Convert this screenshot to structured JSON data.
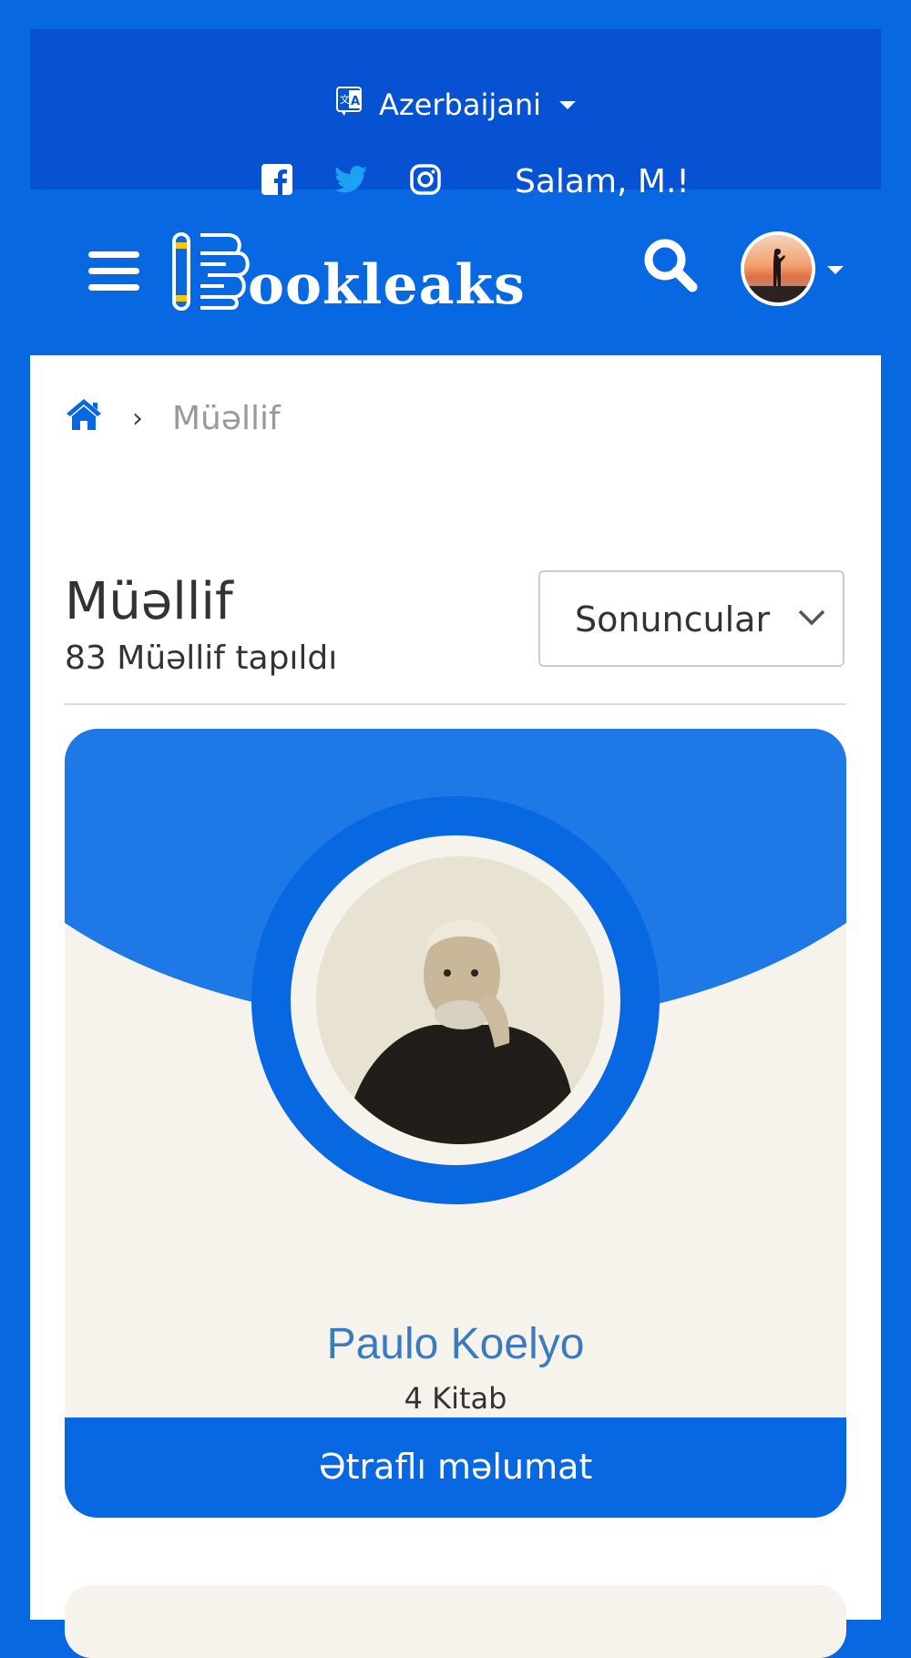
{
  "topbar": {
    "language": "Azerbaijani",
    "greeting": "Salam, M.!"
  },
  "navbar": {
    "logo_text": "ookleaks"
  },
  "breadcrumb": {
    "separator": "›",
    "current": "Müəllif"
  },
  "page": {
    "title": "Müəllif",
    "result_count": "83 Müəllif tapıldı",
    "sort_selected": "Sonuncular"
  },
  "author_card": {
    "name": "Paulo Koelyo",
    "books": "4 Kitab",
    "button_label": "Ətraflı məlumat"
  },
  "colors": {
    "primary": "#0868E2",
    "topbar": "#0652D2",
    "card_light": "#F6F3EC",
    "card_blue": "#1E78E6",
    "author_name": "#3A7BBF",
    "twitter": "#1DA1F2"
  }
}
